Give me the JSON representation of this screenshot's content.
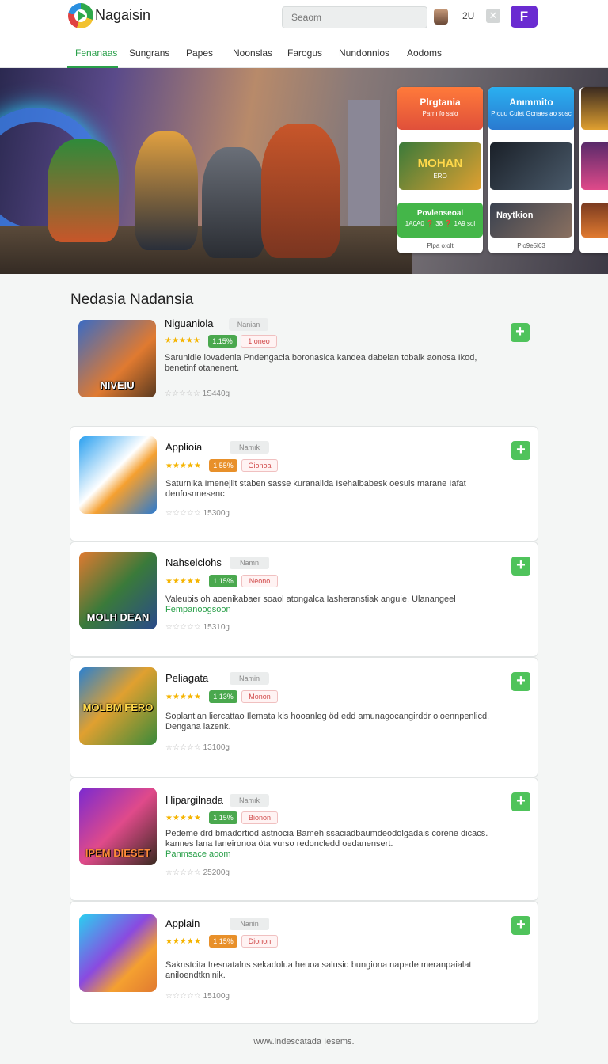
{
  "header": {
    "brand": "Nagaisin",
    "search_placeholder": "Seaom",
    "count": "2U",
    "close_glyph": "✕",
    "profile_letter": "F"
  },
  "tabs": [
    {
      "label": "Fenanaas",
      "active": true
    },
    {
      "label": "Sungrans"
    },
    {
      "label": "Papes"
    },
    {
      "label": "Noonslas"
    },
    {
      "label": "Farogus"
    },
    {
      "label": "Nundonnios"
    },
    {
      "label": "Aodoms"
    }
  ],
  "hero": {
    "cards": [
      {
        "title": "Plrgtania",
        "sub": "Parnı fo salo",
        "color": "#ef6a2c"
      },
      {
        "title": "Anımmito",
        "sub": "Pıouu Cuiet\nGcnaes ao sosc",
        "color": "#2aa6e0"
      },
      {
        "title": "MOHAN",
        "sub": "ERO",
        "color": "#3b7a3a"
      },
      {
        "title": "",
        "sub": "",
        "color": "#2c3440"
      },
      {
        "title": "Povlenseoal",
        "sub": "1A0A0 ❓ 38 ❓ 1A9 sol",
        "color": "#44b649"
      },
      {
        "title": "Naytkion",
        "sub": "",
        "color": "#4a5260"
      }
    ],
    "captions": [
      "Plpa o:olt",
      "Plo9e5l63"
    ]
  },
  "section_title": "Nedasia Nadansia",
  "apps": [
    {
      "name": "Niguaniola",
      "tag": "Nanian",
      "stars": "★★★★★",
      "pct": "1.15%",
      "pct_color": "#4aa84e",
      "pill": "1 oneo",
      "desc": "Sarunidie lovadenia Pndengacia boronasica kandea dabelan tobalk aonosa Ikod, benetinf otanenent.",
      "desc_green": "",
      "meta_stars": "☆☆☆☆☆",
      "meta": "1S440g",
      "icon_label": "NIVEIU",
      "icon_bg": "linear-gradient(135deg,#3a6bc4,#e07a30 60%,#5a3a20)"
    },
    {
      "name": "Applioia",
      "tag": "Namık",
      "stars": "★★★★★",
      "pct": "1.55%",
      "pct_color": "#e8902a",
      "pill": "Gionoa",
      "desc": "Saturnika Imenejilt staben sasse kuranalida Isehaibabesk oesuis marane Iafat denfosnnesenc",
      "desc_green": "",
      "meta_stars": "☆☆☆☆☆",
      "meta": "15300g",
      "icon_label": "",
      "icon_bg": "linear-gradient(135deg,#2aa0f0,#fff 45%,#f5a030 60%,#2a7ad0)"
    },
    {
      "name": "Nahselclohs",
      "tag": "Namn",
      "stars": "★★★★★",
      "pct": "1.15%",
      "pct_color": "#4aa84e",
      "pill": "Neono",
      "desc": "Valeubis oh aoenikabaer soaol atongalca Iasheranstiak anguie. Ulanangeel",
      "desc_green": "Fempanoogsoon",
      "meta_stars": "☆☆☆☆☆",
      "meta": "15310g",
      "icon_label": "MOLH DEAN",
      "icon_bg": "linear-gradient(135deg,#e07a30,#3a7a3a 50%,#2a4a8a)"
    },
    {
      "name": "Peliagata",
      "tag": "Namin",
      "stars": "★★★★★",
      "pct": "1.13%",
      "pct_color": "#4aa84e",
      "pill": "Monon",
      "desc": "Soplantian liercattao Ilemata kis hooanleg öd edd amunagocangirddr oloennpenlicd, Dengana lazenk.",
      "desc_green": "",
      "meta_stars": "☆☆☆☆☆",
      "meta": "13100g",
      "icon_label": "MOLBM FERO",
      "icon_bg": "linear-gradient(135deg,#2a80d0,#e0a030 45%,#3a8a3a)"
    },
    {
      "name": "Hipargilnada",
      "tag": "Namık",
      "stars": "★★★★★",
      "pct": "1.15%",
      "pct_color": "#4aa84e",
      "pill": "Bionon",
      "desc": "Pedeme drd bmadortiod astnocia Bameh ssaciadbaumdeodolgadais corene dicacs. kannes lana Ianeironoa öta vurso redoncledd oedanensert.",
      "desc_green": "Panmsace aoom",
      "meta_stars": "☆☆☆☆☆",
      "meta": "25200g",
      "icon_label": "IPEM DIESET",
      "icon_bg": "linear-gradient(135deg,#7a2ad0,#e04a8a 50%,#3a2a20)"
    },
    {
      "name": "Applain",
      "tag": "Nanin",
      "stars": "★★★★★",
      "pct": "1.15%",
      "pct_color": "#e8902a",
      "pill": "Dionon",
      "desc": "Saknstcita Iresnatalns sekadolua heuoa salusid bungiona napede meranpaialat aniloendtkninik.",
      "desc_green": "",
      "meta_stars": "☆☆☆☆☆",
      "meta": "15100g",
      "icon_label": "",
      "icon_bg": "linear-gradient(135deg,#2ad0f0,#8a4ae0 45%,#f5a030 70%,#e07a30)"
    }
  ],
  "footer": "www.indescatada Iesems."
}
